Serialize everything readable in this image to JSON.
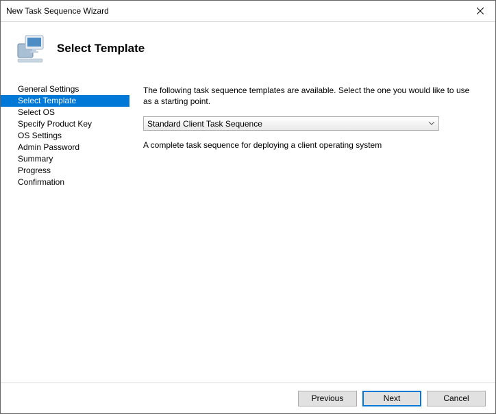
{
  "titlebar": {
    "title": "New Task Sequence Wizard"
  },
  "header": {
    "page_title": "Select Template"
  },
  "sidebar": {
    "items": [
      {
        "label": "General Settings",
        "selected": false
      },
      {
        "label": "Select Template",
        "selected": true
      },
      {
        "label": "Select OS",
        "selected": false
      },
      {
        "label": "Specify Product Key",
        "selected": false
      },
      {
        "label": "OS Settings",
        "selected": false
      },
      {
        "label": "Admin Password",
        "selected": false
      },
      {
        "label": "Summary",
        "selected": false
      },
      {
        "label": "Progress",
        "selected": false
      },
      {
        "label": "Confirmation",
        "selected": false
      }
    ]
  },
  "content": {
    "instruction": "The following task sequence templates are available.  Select the one you would like to use as a starting point.",
    "dropdown_selected": "Standard Client Task Sequence",
    "description": "A complete task sequence for deploying a client operating system"
  },
  "footer": {
    "previous": "Previous",
    "next": "Next",
    "cancel": "Cancel"
  }
}
